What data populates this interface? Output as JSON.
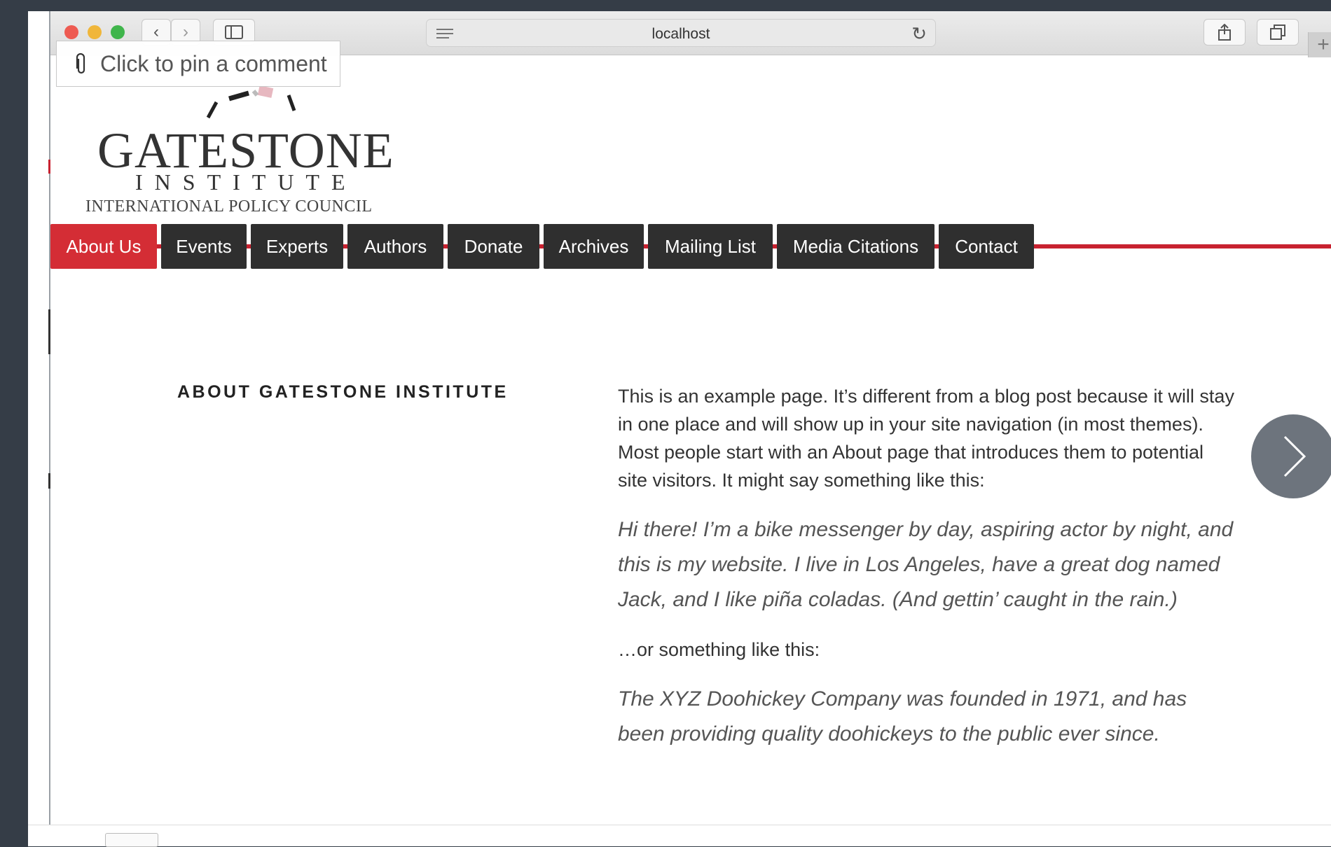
{
  "browser": {
    "url": "localhost"
  },
  "pin_comment": {
    "label": "Click to pin a comment"
  },
  "logo": {
    "name": "GATESTONE",
    "sub": "INSTITUTE",
    "tagline": "INTERNATIONAL POLICY COUNCIL"
  },
  "nav": {
    "items": [
      {
        "label": "About Us",
        "active": true
      },
      {
        "label": "Events"
      },
      {
        "label": "Experts"
      },
      {
        "label": "Authors"
      },
      {
        "label": "Donate"
      },
      {
        "label": "Archives"
      },
      {
        "label": "Mailing List"
      },
      {
        "label": "Media Citations"
      },
      {
        "label": "Contact"
      }
    ]
  },
  "page": {
    "heading": "ABOUT GATESTONE INSTITUTE",
    "intro": "This is an example page. It’s different from a blog post because it will stay in one place and will show up in your site navigation (in most themes). Most people start with an About page that introduces them to potential site visitors. It might say something like this:",
    "quote1": "Hi there! I’m a bike messenger by day, aspiring actor by night, and this is my website. I live in Los Angeles, have a great dog named Jack, and I like piña coladas. (And gettin’ caught in the rain.)",
    "or_text": "…or something like this:",
    "quote2": "The XYZ Doohickey Company was founded in 1971, and has been providing quality doohickeys to the public ever since."
  },
  "colors": {
    "accent": "#d42d35",
    "nav_bg": "#2f2f2f",
    "backdrop": "#353d47"
  },
  "icons": {
    "next": "chevron-right-icon",
    "pin": "paperclip-icon"
  }
}
